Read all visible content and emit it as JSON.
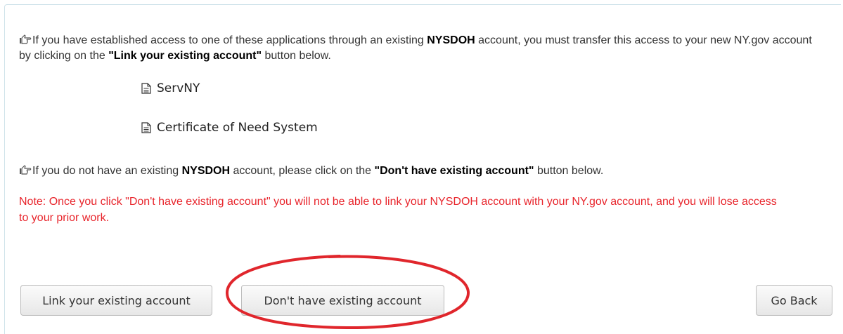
{
  "info": {
    "p1_pre": "If you have established access to one of these applications through an existing ",
    "p1_bold1": "NYSDOH",
    "p1_mid": " account, you must transfer this access to your new NY.gov account by clicking on the ",
    "p1_bold2": "\"Link your existing account\"",
    "p1_post": " button below.",
    "p2_pre": "If you do not have an existing ",
    "p2_bold1": "NYSDOH",
    "p2_mid": " account, please click on the ",
    "p2_bold2": "\"Don't have existing account\"",
    "p2_post": " button below."
  },
  "applications": [
    {
      "label": "ServNY",
      "icon": "document-icon"
    },
    {
      "label": "Certificate of Need System",
      "icon": "document-icon"
    }
  ],
  "note": "Note: Once you click \"Don't have existing account\" you will not be able to link your NYSDOH account with your NY.gov account, and you will lose access to your prior work.",
  "buttons": {
    "link_label": "Link your existing account",
    "dont_label": "Don't have existing account",
    "back_label": "Go Back"
  },
  "colors": {
    "note": "#e8242b",
    "annotation_circle": "#e0262c",
    "panel_border": "#cfe3ea"
  },
  "icons": {
    "pointer": "hand-pointing-right-icon"
  }
}
